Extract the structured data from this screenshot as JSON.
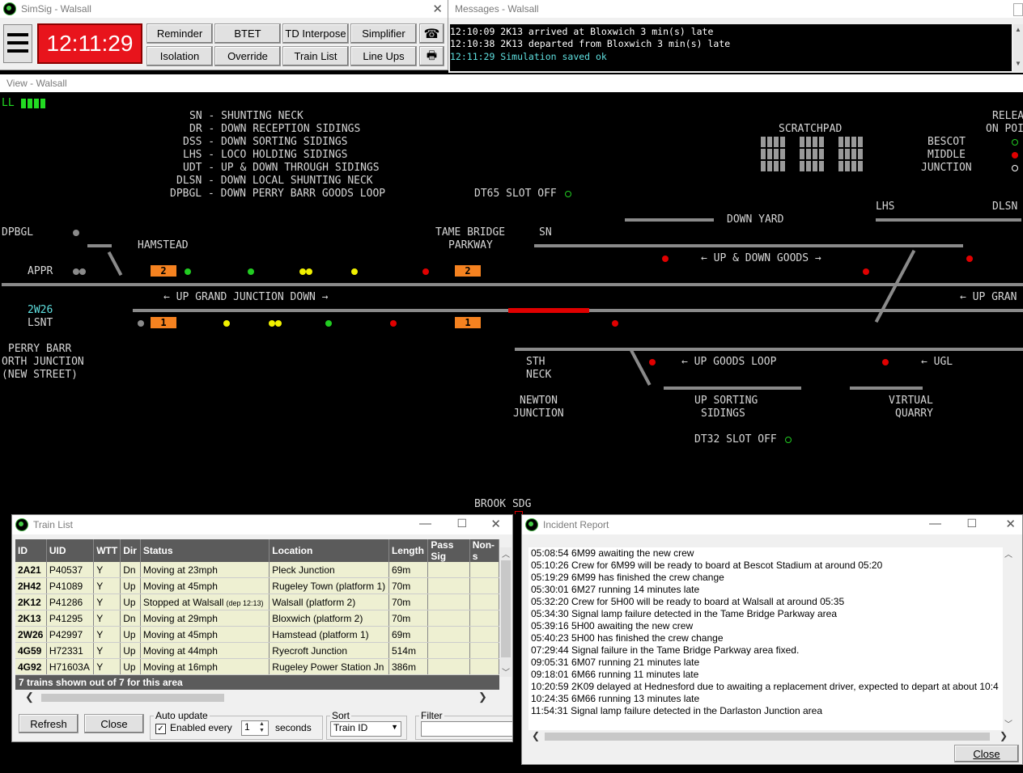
{
  "main_window": {
    "title": "SimSig - Walsall",
    "clock": "12:11:29",
    "buttons": {
      "reminder": "Reminder",
      "btet": "BTET",
      "td_interpose": "TD Interpose",
      "simplifier": "Simplifier",
      "isolation": "Isolation",
      "override": "Override",
      "train_list": "Train List",
      "line_ups": "Line Ups"
    }
  },
  "messages_window": {
    "title": "Messages - Walsall",
    "lines": [
      {
        "text": "12:10:09 2K13 arrived at Bloxwich 3 min(s) late",
        "color": "#ffffff"
      },
      {
        "text": "12:10:38 2K13 departed from Bloxwich 3 min(s) late",
        "color": "#ffffff"
      },
      {
        "text": "12:11:29 Simulation saved ok",
        "color": "#5fe0e0"
      }
    ]
  },
  "view_window": {
    "title": "View - Walsall",
    "status": "LL",
    "legend": [
      "SN - SHUNTING NECK",
      "DR - DOWN RECEPTION SIDINGS",
      "DSS - DOWN SORTING SIDINGS",
      "LHS - LOCO HOLDING SIDINGS",
      "UDT - UP & DOWN THROUGH SIDINGS",
      "DLSN - DOWN LOCAL SHUNTING NECK",
      "DPBGL - DOWN PERRY BARR GOODS LOOP"
    ],
    "scratchpad": "SCRATCHPAD",
    "release": [
      "RELEA",
      "ON POI"
    ],
    "release_items": [
      "BESCOT",
      "MIDDLE",
      "JUNCTION"
    ],
    "labels": {
      "dt65": "DT65 SLOT OFF",
      "dt32": "DT32 SLOT OFF",
      "dpbgl": "DPBGL",
      "hamstead": "HAMSTEAD",
      "appr": "APPR",
      "train_id": "2W26",
      "lsnt": "LSNT",
      "perry_barr": [
        "PERRY BARR",
        "ORTH JUNCTION",
        "(NEW STREET)"
      ],
      "tame_bridge": [
        "TAME BRIDGE",
        "PARKWAY"
      ],
      "sn": "SN",
      "down_yard": "DOWN YARD",
      "lhs": "LHS",
      "dlsn": "DLSN",
      "up_down_goods": "UP & DOWN GOODS",
      "up_grand_junction_down": "UP GRAND JUNCTION DOWN",
      "up_gran": "UP GRAN",
      "sth_neck": [
        "STH",
        "NECK"
      ],
      "up_goods_loop": "UP GOODS LOOP",
      "ugl": "UGL",
      "newton_junction": [
        "NEWTON",
        "JUNCTION"
      ],
      "up_sorting_sidings": [
        "UP SORTING",
        "SIDINGS"
      ],
      "virtual_quarry": [
        "VIRTUAL",
        "QUARRY"
      ],
      "brook_sdg": "BROOK SDG",
      "platform_2": "2",
      "platform_1": "1"
    }
  },
  "train_list": {
    "title": "Train List",
    "columns": [
      "ID",
      "UID",
      "WTT",
      "Dir",
      "Status",
      "Location",
      "Length",
      "Pass Sig",
      "Non-s"
    ],
    "rows": [
      {
        "id": "2A21",
        "uid": "P40537",
        "wtt": "Y",
        "dir": "Dn",
        "status": "Moving at 23mph",
        "status_extra": "",
        "location": "Pleck Junction",
        "length": "69m"
      },
      {
        "id": "2H42",
        "uid": "P41089",
        "wtt": "Y",
        "dir": "Up",
        "status": "Moving at 45mph",
        "status_extra": "",
        "location": "Rugeley Town (platform 1)",
        "length": "70m"
      },
      {
        "id": "2K12",
        "uid": "P41286",
        "wtt": "Y",
        "dir": "Up",
        "status": "Stopped at Walsall",
        "status_extra": "(dep 12:13)",
        "location": "Walsall (platform 2)",
        "length": "70m"
      },
      {
        "id": "2K13",
        "uid": "P41295",
        "wtt": "Y",
        "dir": "Dn",
        "status": "Moving at 29mph",
        "status_extra": "",
        "location": "Bloxwich (platform 2)",
        "length": "70m"
      },
      {
        "id": "2W26",
        "uid": "P42997",
        "wtt": "Y",
        "dir": "Up",
        "status": "Moving at 45mph",
        "status_extra": "",
        "location": "Hamstead (platform 1)",
        "length": "69m"
      },
      {
        "id": "4G59",
        "uid": "H72331",
        "wtt": "Y",
        "dir": "Up",
        "status": "Moving at 44mph",
        "status_extra": "",
        "location": "Ryecroft Junction",
        "length": "514m"
      },
      {
        "id": "4G92",
        "uid": "H71603A",
        "wtt": "Y",
        "dir": "Up",
        "status": "Moving at 16mph",
        "status_extra": "",
        "location": "Rugeley Power Station Jn",
        "length": "386m"
      }
    ],
    "footer": "7 trains shown out of 7 for this area",
    "refresh": "Refresh",
    "close": "Close",
    "auto_update_label": "Auto update",
    "enabled_every": "Enabled every",
    "interval": "1",
    "seconds": "seconds",
    "sort_label": "Sort",
    "sort_value": "Train ID",
    "filter_label": "Filter"
  },
  "incident_report": {
    "title": "Incident Report",
    "lines": [
      "05:08:54 6M99 awaiting the new crew",
      "05:10:26 Crew for 6M99 will be ready to board at Bescot Stadium at around 05:20",
      "05:19:29 6M99 has finished the crew change",
      "05:30:01 6M27 running 14 minutes late",
      "05:32:20 Crew for 5H00 will be ready to board at Walsall at around 05:35",
      "05:34:30 Signal lamp failure detected in the Tame Bridge Parkway area",
      "05:39:16 5H00 awaiting the new crew",
      "05:40:23 5H00 has finished the crew change",
      "07:29:44 Signal failure in the Tame Bridge Parkway area fixed.",
      "09:05:31 6M07 running 21 minutes late",
      "09:18:01 6M66 running 11 minutes late",
      "10:20:59 2K09 delayed at Hednesford due to awaiting a replacement driver, expected to depart at about 10:4",
      "10:24:35 6M66 running 13 minutes late",
      "11:54:31 Signal lamp failure detected in the Darlaston Junction area"
    ],
    "close": "Close"
  },
  "colors": {
    "track": "#8a8a8a",
    "occupied": "#e00000",
    "platform": "#f58220",
    "clock_bg": "#e8141c",
    "signal_red": "#e00000",
    "signal_green": "#22cc22",
    "signal_yellow": "#f0f000"
  }
}
